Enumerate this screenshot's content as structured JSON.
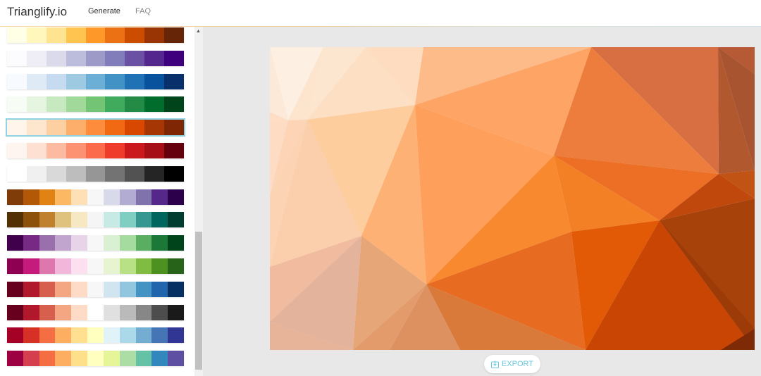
{
  "header": {
    "logo": "Trianglify.io",
    "nav": [
      {
        "label": "Generate"
      },
      {
        "label": "FAQ"
      }
    ]
  },
  "sidebar": {
    "selected_index": 4,
    "palettes": [
      [
        "#ffffe5",
        "#fff7bc",
        "#fee391",
        "#fec44f",
        "#fe9929",
        "#ec7014",
        "#cc4c02",
        "#993404",
        "#662506"
      ],
      [
        "#fcfbfd",
        "#efedf5",
        "#dadaeb",
        "#bcbddc",
        "#9e9ac8",
        "#807dba",
        "#6a51a3",
        "#54278f",
        "#3f007d"
      ],
      [
        "#f7fbff",
        "#deebf7",
        "#c6dbef",
        "#9ecae1",
        "#6baed6",
        "#4292c6",
        "#2171b5",
        "#08519c",
        "#08306b"
      ],
      [
        "#f7fcf5",
        "#e5f5e0",
        "#c7e9c0",
        "#a1d99b",
        "#74c476",
        "#41ab5d",
        "#238b45",
        "#006d2c",
        "#00441b"
      ],
      [
        "#fff5eb",
        "#fee6ce",
        "#fdd0a2",
        "#fdae6b",
        "#fd8d3c",
        "#f16913",
        "#d94801",
        "#a63603",
        "#7f2704"
      ],
      [
        "#fff5f0",
        "#fee0d2",
        "#fcbba1",
        "#fc9272",
        "#fb6a4a",
        "#ef3b2c",
        "#cb181d",
        "#a50f15",
        "#67000d"
      ],
      [
        "#ffffff",
        "#f0f0f0",
        "#d9d9d9",
        "#bdbdbd",
        "#969696",
        "#737373",
        "#525252",
        "#252525",
        "#000000"
      ],
      [
        "#7f3b08",
        "#b35806",
        "#e08214",
        "#fdb863",
        "#fee0b6",
        "#f7f7f7",
        "#d8daeb",
        "#b2abd2",
        "#8073ac",
        "#542788",
        "#2d004b"
      ],
      [
        "#543005",
        "#8c510a",
        "#bf812d",
        "#dfc27d",
        "#f6e8c3",
        "#f5f5f5",
        "#c7eae5",
        "#80cdc1",
        "#35978f",
        "#01665e",
        "#003c30"
      ],
      [
        "#40004b",
        "#762a83",
        "#9970ab",
        "#c2a5cf",
        "#e7d4e8",
        "#f7f7f7",
        "#d9f0d3",
        "#a6dba0",
        "#5aae61",
        "#1b7837",
        "#00441b"
      ],
      [
        "#8e0152",
        "#c51b7d",
        "#de77ae",
        "#f1b6da",
        "#fde0ef",
        "#f7f7f7",
        "#e6f5d0",
        "#b8e186",
        "#7fbc41",
        "#4d9221",
        "#276419"
      ],
      [
        "#67001f",
        "#b2182b",
        "#d6604d",
        "#f4a582",
        "#fddbc7",
        "#f7f7f7",
        "#d1e5f0",
        "#92c5de",
        "#4393c3",
        "#2166ac",
        "#053061"
      ],
      [
        "#67001f",
        "#b2182b",
        "#d6604d",
        "#f4a582",
        "#fddbc7",
        "#ffffff",
        "#e0e0e0",
        "#bababa",
        "#878787",
        "#4d4d4d",
        "#1a1a1a"
      ],
      [
        "#a50026",
        "#d73027",
        "#f46d43",
        "#fdae61",
        "#fee090",
        "#ffffbf",
        "#e0f3f8",
        "#abd9e9",
        "#74add1",
        "#4575b4",
        "#313695"
      ],
      [
        "#9e0142",
        "#d53e4f",
        "#f46d43",
        "#fdae61",
        "#fee08b",
        "#ffffbf",
        "#e6f598",
        "#abdda4",
        "#66c2a5",
        "#3288bd",
        "#5e4fa2"
      ]
    ]
  },
  "main": {
    "export_label": "EXPORT",
    "export_icon": "download-icon",
    "background_color": "#e8e8e8"
  }
}
